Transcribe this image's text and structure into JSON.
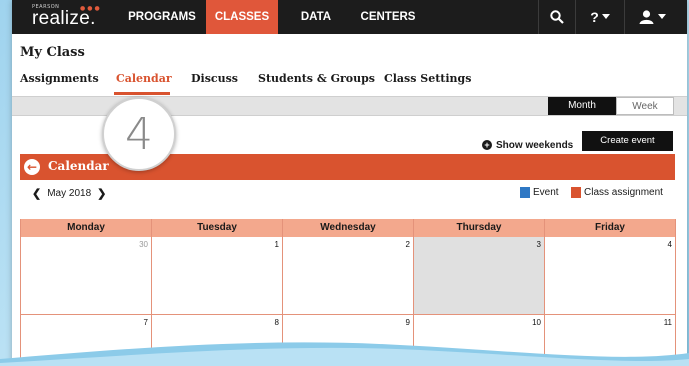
{
  "topnav": {
    "logo_small": "PEARSON",
    "logo": "realize.",
    "items": [
      {
        "label": "PROGRAMS"
      },
      {
        "label": "CLASSES"
      },
      {
        "label": "DATA"
      },
      {
        "label": "CENTERS"
      }
    ],
    "active_index": 1,
    "icons": [
      "search-icon",
      "help-icon",
      "user-icon"
    ],
    "help_label": "?",
    "accent": "#e0573a"
  },
  "header": {
    "title": "My Class",
    "tabs": [
      {
        "label": "Assignments"
      },
      {
        "label": "Calendar"
      },
      {
        "label": "Discuss"
      },
      {
        "label": "Students & Groups"
      },
      {
        "label": "Class Settings"
      }
    ],
    "active_tab": "Calendar"
  },
  "view_toggle": {
    "month": "Month",
    "week": "Week",
    "selected": "Month"
  },
  "step_badge": "4",
  "actions": {
    "show_weekends": "Show weekends",
    "create_event": "Create event"
  },
  "calendar": {
    "title": "Calendar",
    "month_label": "May 2018",
    "legend": [
      {
        "label": "Event",
        "color": "#2f78c4"
      },
      {
        "label": "Class assignment",
        "color": "#d9532f"
      }
    ],
    "days": [
      "Monday",
      "Tuesday",
      "Wednesday",
      "Thursday",
      "Friday"
    ],
    "weeks": [
      [
        "30",
        "1",
        "2",
        "3",
        "4"
      ],
      [
        "7",
        "8",
        "9",
        "10",
        "11"
      ]
    ],
    "today": "3",
    "band_color": "#d9532f",
    "header_color": "#f3a88d"
  }
}
